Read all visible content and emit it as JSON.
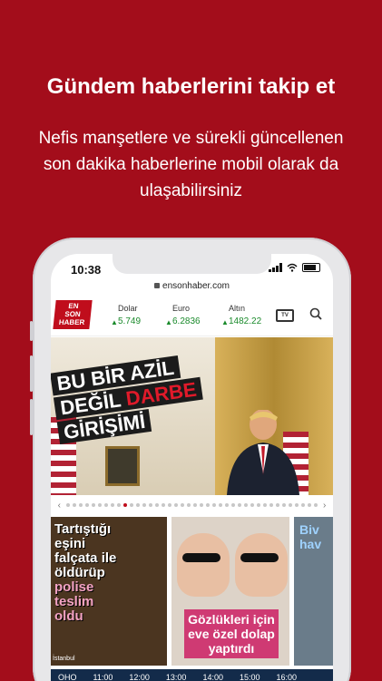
{
  "headline": "Gündem haberlerini takip et",
  "subtext": "Nefis manşetlere ve sürekli güncellenen son dakika haberlerine mobil olarak da ulaşabilirsiniz",
  "colors": {
    "background": "#a30d1b",
    "brand_red": "#c00d1c",
    "ticker_green": "#1a8a2b"
  },
  "status_bar": {
    "time": "10:38"
  },
  "browser": {
    "url": "ensonhaber.com"
  },
  "header": {
    "logo": [
      "EN",
      "SON",
      "HABER"
    ],
    "tickers": [
      {
        "label": "Dolar",
        "value": "5.749"
      },
      {
        "label": "Euro",
        "value": "6.2836"
      },
      {
        "label": "Altın",
        "value": "1482.22"
      }
    ],
    "tv_label": "TV",
    "icons": [
      "tv-icon",
      "search-icon"
    ]
  },
  "hero": {
    "lines": [
      "BU BİR AZİL",
      "DEĞİL DARBE",
      "GİRİŞİMİ"
    ],
    "highlight": "DARBE"
  },
  "slider": {
    "total_dots": 40,
    "active_index": 9
  },
  "cards": [
    {
      "text_lines": [
        "Tartıştığı eşini",
        "falçata ile",
        "öldürüp"
      ],
      "highlight_lines": [
        "polise",
        "teslim",
        "oldu"
      ],
      "source": "İstanbul"
    },
    {
      "text_lines": [
        "Gözlükleri için",
        "eve özel dolap",
        "yaptırdı"
      ]
    },
    {
      "text_lines": [
        "Biv",
        "hav"
      ]
    }
  ],
  "weather_bar": {
    "labels": [
      "OHO",
      "11:00",
      "12:00",
      "13:00",
      "14:00",
      "15:00",
      "16:00"
    ]
  }
}
